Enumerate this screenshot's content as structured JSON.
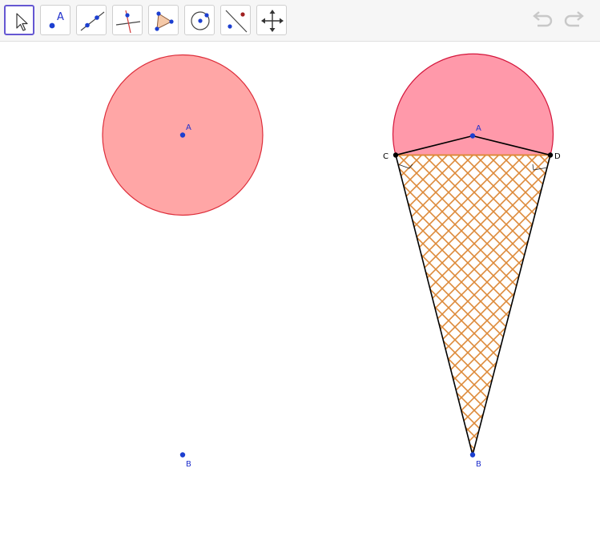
{
  "toolbar": {
    "tools": [
      {
        "id": "move",
        "icon": "arrow-pointer-icon",
        "active": true
      },
      {
        "id": "point",
        "icon": "point-icon",
        "active": false
      },
      {
        "id": "line",
        "icon": "line-icon",
        "active": false
      },
      {
        "id": "perpendicular",
        "icon": "perpendicular-line-icon",
        "active": false
      },
      {
        "id": "polygon",
        "icon": "polygon-icon",
        "active": false
      },
      {
        "id": "circle",
        "icon": "circle-with-center-icon",
        "active": false
      },
      {
        "id": "reflect",
        "icon": "reflect-about-line-icon",
        "active": false
      },
      {
        "id": "move-graphics",
        "icon": "move-graphics-view-icon",
        "active": false
      }
    ],
    "point_tool_label": "A",
    "undo_icon": "undo-icon",
    "redo_icon": "redo-icon"
  },
  "left_figure": {
    "center_label": "A",
    "bottom_point_label": "B"
  },
  "right_figure": {
    "top_label": "A",
    "left_label": "C",
    "right_label": "D",
    "bottom_label": "B"
  },
  "colors": {
    "left_circle_fill": "#ffa6a6",
    "left_circle_stroke": "#dd2d3a",
    "right_cap_fill": "#ff99aa",
    "right_cap_stroke": "#d4143a",
    "cone_hatch": "#dd8a3a",
    "cone_outline": "#000000",
    "point_blue": "#1c3fd0",
    "label_blue": "#2030cc",
    "tool_active_border": "#6557d2",
    "undo_redo": "#c8c8c8"
  }
}
